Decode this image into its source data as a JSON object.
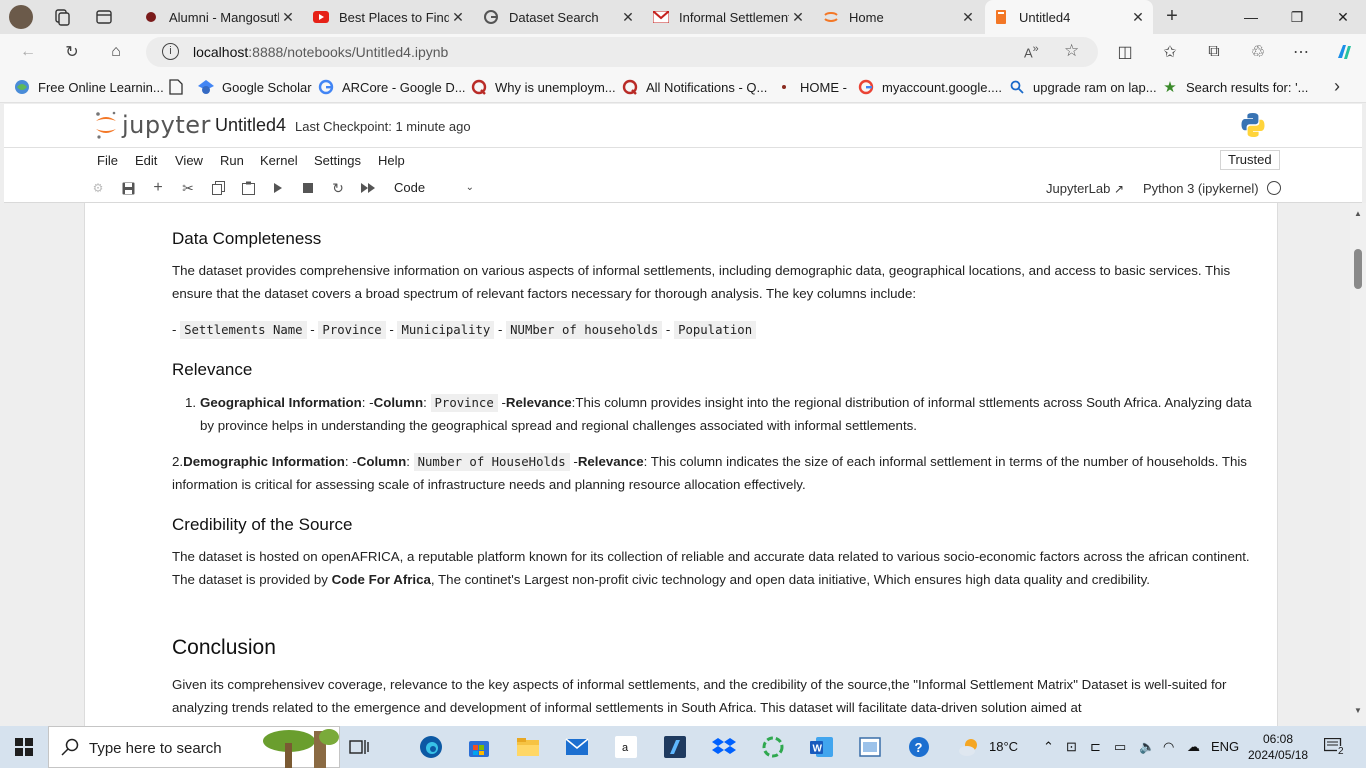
{
  "browser": {
    "tabs": [
      {
        "label": "Alumni - Mangosuthu",
        "icon": "mangosuthu-icon"
      },
      {
        "label": "Best Places to Find D",
        "icon": "youtube-icon"
      },
      {
        "label": "Dataset Search",
        "icon": "google-icon"
      },
      {
        "label": "Informal Settlement",
        "icon": "gmail-icon"
      },
      {
        "label": "Home",
        "icon": "jupyter-icon"
      },
      {
        "label": "Untitled4",
        "icon": "jupyter-notebook-icon"
      }
    ],
    "url_host": "localhost",
    "url_path": ":8888/notebooks/Untitled4.ipynb",
    "favorites": [
      "Free Online Learnin...",
      "Google Scholar",
      "ARCore - Google D...",
      "Why is unemploym...",
      "All Notifications - Q...",
      "HOME -",
      "myaccount.google....",
      "upgrade ram on lap...",
      "Search results for: '..."
    ]
  },
  "jupyter": {
    "logo_text": "jupyter",
    "notebook_title": "Untitled4",
    "checkpoint": "Last Checkpoint: 1 minute ago",
    "menu": [
      "File",
      "Edit",
      "View",
      "Run",
      "Kernel",
      "Settings",
      "Help"
    ],
    "trusted": "Trusted",
    "cell_type": "Code",
    "jupyterlab_link": "JupyterLab",
    "kernel": "Python 3 (ipykernel)"
  },
  "notebook": {
    "completeness_heading": "Data Completeness",
    "completeness_p1": "The dataset provides comprehensive information on various aspects of informal settlements, including demographic data, geographical locations, and access to basic services. This ensure that the dataset covers a broad spectrum of relevant factors necessary for thorough analysis. The key columns include:",
    "columns": [
      "Settlements Name",
      "Province",
      "Municipality",
      "NUMber of households",
      "Population"
    ],
    "relevance_heading": "Relevance",
    "rel1_num": "1.",
    "rel1_title": "Geographical Information",
    "rel1_colword": "Column",
    "rel1_col": "Province",
    "rel1_relword": "Relevance",
    "rel1_text": "This column provides insight into the regional distribution of informal sttlements across South Africa. Analyzing data by province helps in understanding the geographical spread and regional challenges associated with informal settlements.",
    "rel2_num": "2.",
    "rel2_title": "Demographic Information",
    "rel2_colword": "Column",
    "rel2_col": "Number of HouseHolds",
    "rel2_relword": "Relevance",
    "rel2_text": " This column indicates the size of each informal settlement in terms of the number of households. This information is critical for assessing scale of infrastructure needs and planning resource allocation effectively.",
    "credibility_heading": "Credibility of the Source",
    "cred_text_a": "The dataset is hosted on openAFRICA, a reputable platform known for its collection of reliable and accurate data related to various socio-economic factors across the african continent. The dataset is provided by ",
    "cred_bold": "Code For Africa",
    "cred_text_b": ", The continet's Largest non-profit civic technology and open data initiative, Which ensures high data quality and credibility.",
    "conclusion_heading": "Conclusion",
    "conclusion_text": "Given its comprehensivev coverage, relevance to the key aspects of informal settlements, and the credibility of the source,the \"Informal Settlement Matrix\" Dataset is well-suited for analyzing trends related to the emergence and development of informal settlements in South Africa. This dataset will facilitate data-driven solution aimed at"
  },
  "taskbar": {
    "search_placeholder": "Type here to search",
    "temperature": "18°C",
    "language": "ENG",
    "time": "06:08",
    "date": "2024/05/18",
    "notification_count": "2"
  },
  "colors": {
    "jupyter_orange": "#f37726",
    "taskbar_bg": "#d6e2ee",
    "edge_blue": "#0c59a4"
  }
}
